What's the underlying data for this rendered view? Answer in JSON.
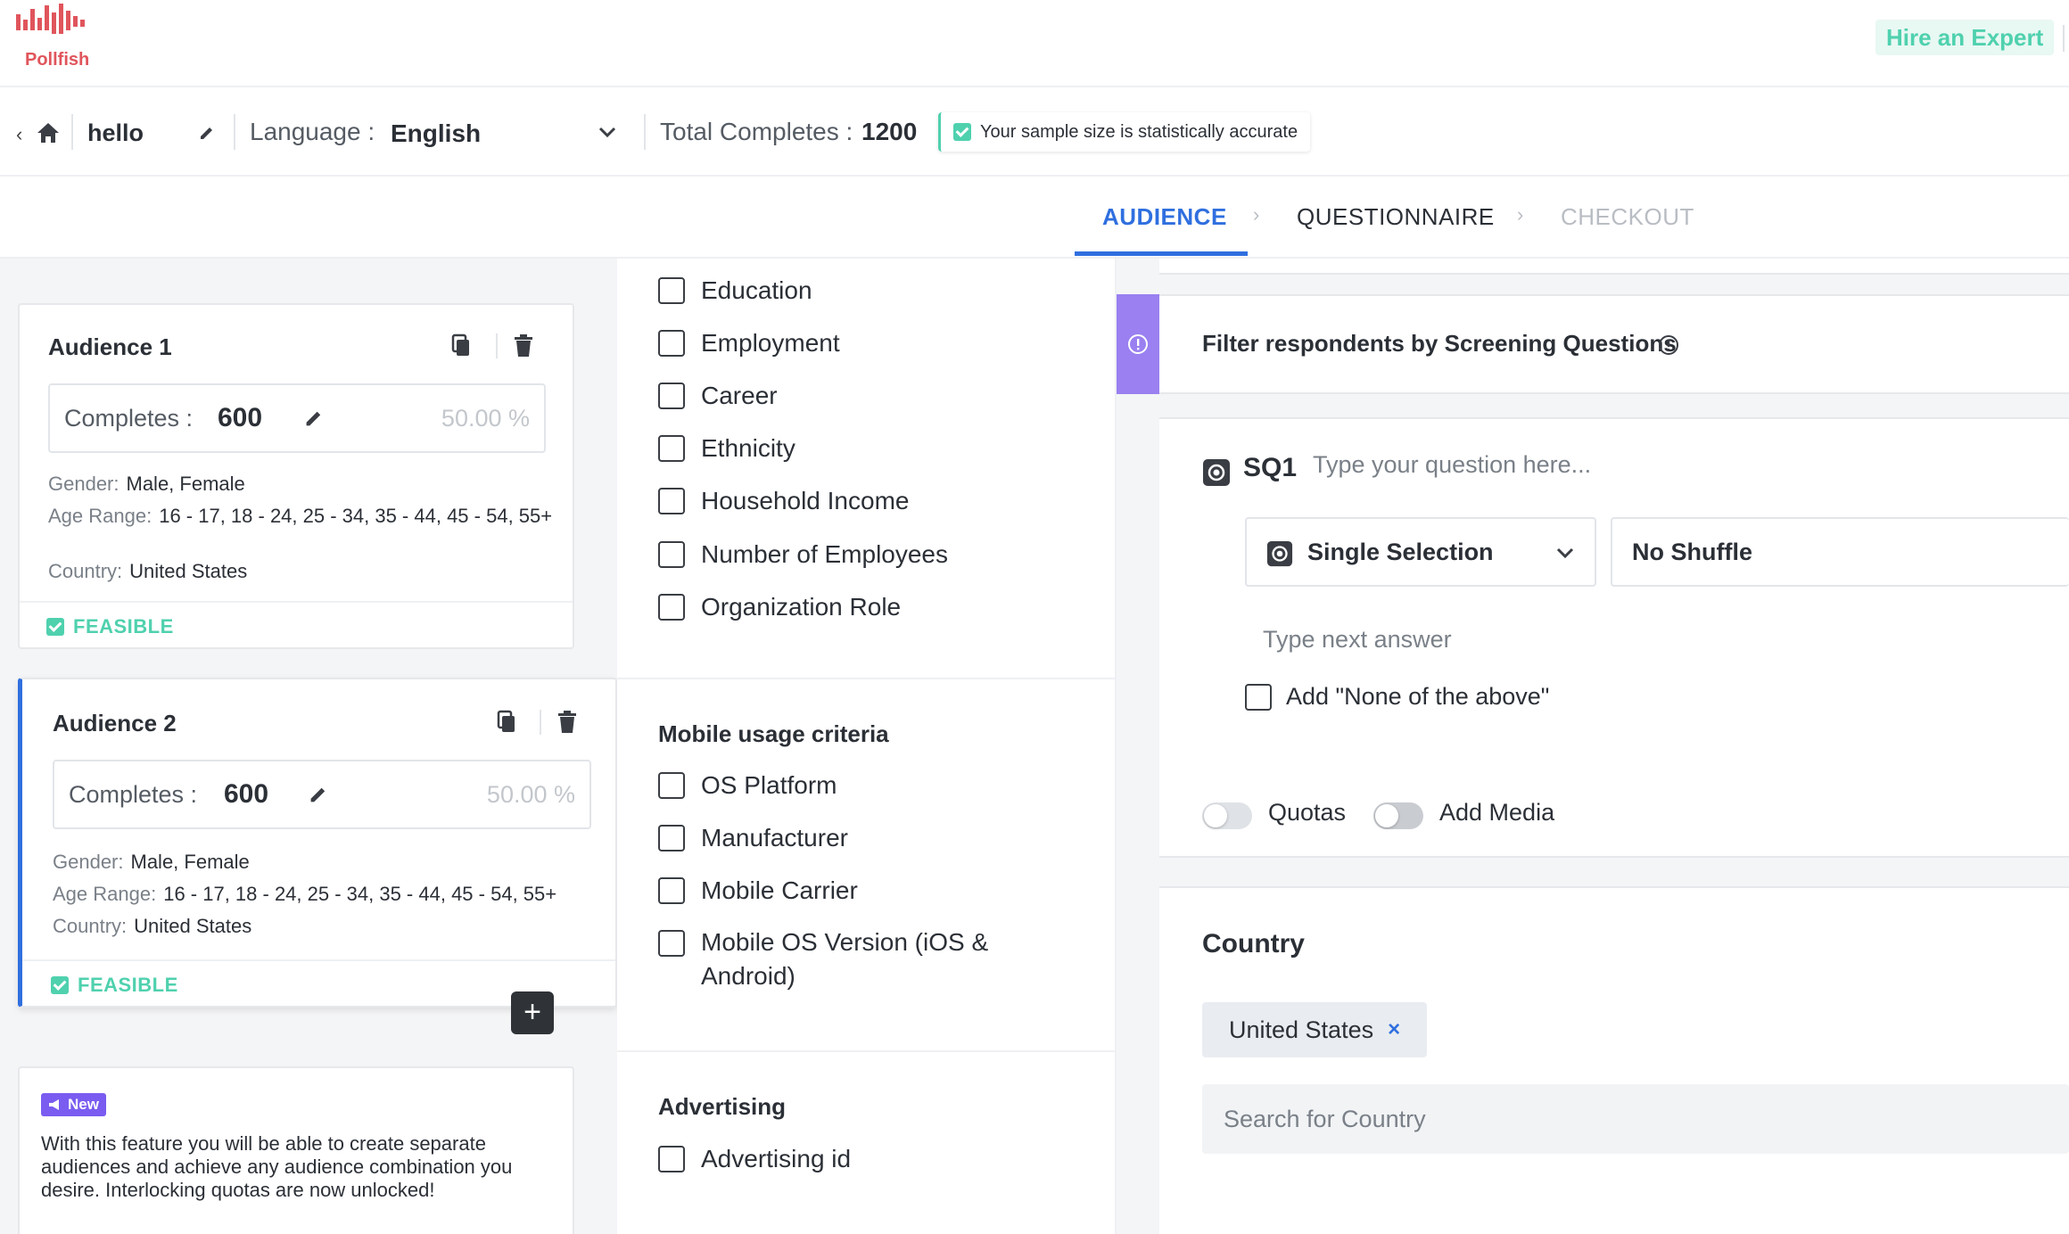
{
  "header": {
    "logo_text": "Pollfish",
    "hire_button": "Hire an Expert"
  },
  "survey_bar": {
    "survey_name": "hello",
    "language_label": "Language :",
    "language_value": "English",
    "total_completes_label": "Total Completes :",
    "total_completes_value": "1200",
    "accuracy_text": "Your sample size is statistically accurate"
  },
  "steps": [
    {
      "label": "AUDIENCE",
      "state": "active"
    },
    {
      "label": "QUESTIONNAIRE",
      "state": "normal"
    },
    {
      "label": "CHECKOUT",
      "state": "disabled"
    }
  ],
  "audiences": [
    {
      "title": "Audience 1",
      "completes_label": "Completes :",
      "completes_value": "600",
      "percent": "50.00 %",
      "gender_label": "Gender:",
      "gender_value": "Male, Female",
      "age_label": "Age Range:",
      "age_value": "16 - 17, 18 - 24, 25 - 34, 35 - 44, 45 - 54, 55+",
      "country_label": "Country:",
      "country_value": "United States",
      "status": "FEASIBLE"
    },
    {
      "title": "Audience 2",
      "completes_label": "Completes :",
      "completes_value": "600",
      "percent": "50.00 %",
      "gender_label": "Gender:",
      "gender_value": "Male, Female",
      "age_label": "Age Range:",
      "age_value": "16 - 17, 18 - 24, 25 - 34, 35 - 44, 45 - 54, 55+",
      "country_label": "Country:",
      "country_value": "United States",
      "status": "FEASIBLE"
    }
  ],
  "add_audience_label": "+",
  "news": {
    "badge": "New",
    "text": "With this feature you will be able to create separate audiences and achieve any audience combination you desire. Interlocking quotas are now unlocked!"
  },
  "criteria": {
    "group1": [
      "Education",
      "Employment",
      "Career",
      "Ethnicity",
      "Household Income",
      "Number of Employees",
      "Organization Role"
    ],
    "mobile_heading": "Mobile usage criteria",
    "mobile": [
      "OS Platform",
      "Manufacturer",
      "Mobile Carrier",
      "Mobile OS Version (iOS & Android)"
    ],
    "advertising_heading": "Advertising",
    "advertising": [
      "Advertising id"
    ]
  },
  "screening": {
    "banner_text": "Filter respondents by Screening Questions",
    "sq_label": "SQ1",
    "question_placeholder": "Type your question here...",
    "selection_type": "Single Selection",
    "shuffle": "No Shuffle",
    "answer_placeholder": "Type next answer",
    "none_above": "Add \"None of the above\"",
    "quotas_label": "Quotas",
    "media_label": "Add Media"
  },
  "country": {
    "title": "Country",
    "selected": "United States",
    "remove": "×",
    "search_placeholder": "Search for Country"
  },
  "colors": {
    "accent_blue": "#2f6fdf",
    "teal": "#4fd1ae",
    "purple": "#9a80f0",
    "logo_red": "#e0555c"
  }
}
